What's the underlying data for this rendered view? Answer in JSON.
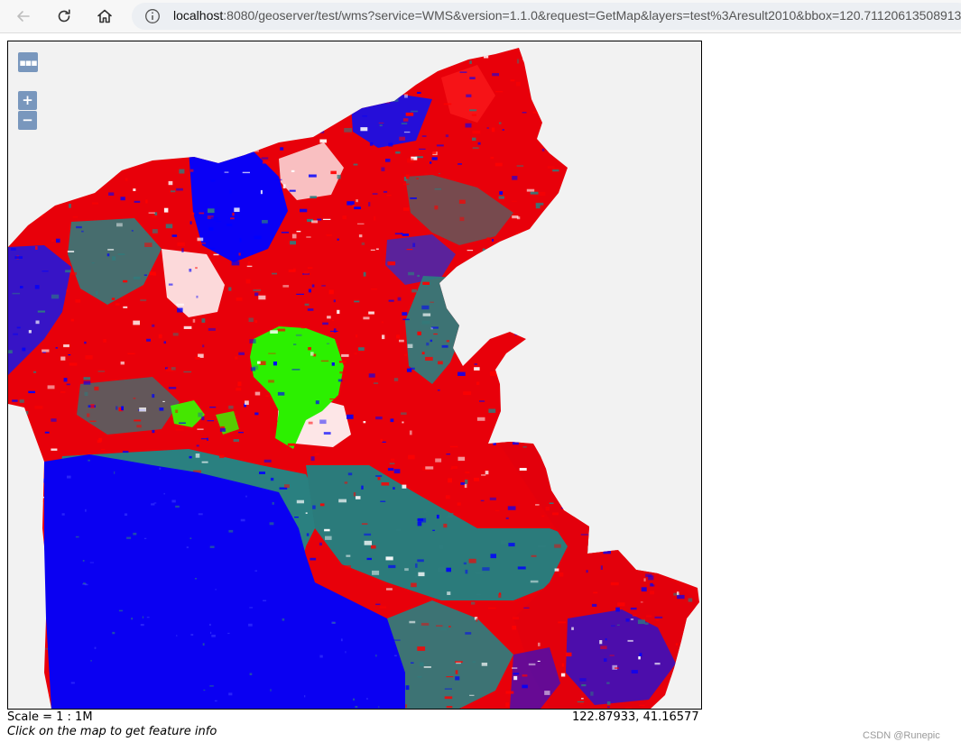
{
  "browser": {
    "url_host": "localhost",
    "url_rest": ":8080/geoserver/test/wms?service=WMS&version=1.1.0&request=GetMap&layers=test%3Aresult2010&bbox=120.71120613508913"
  },
  "map": {
    "controls": {
      "toggle_label": "▪▪▪",
      "zoom_in_label": "+",
      "zoom_out_label": "−"
    },
    "legend_colors": {
      "class_red": "#ff0000",
      "class_blue": "#0000ff",
      "class_teal": "#2e7d7e",
      "class_green": "#33ff00",
      "background": "#f2f2f2"
    }
  },
  "footer": {
    "scale": "Scale = 1 : 1M",
    "coordinates": "122.87933, 41.16577",
    "hint": "Click on the map to get feature info"
  },
  "watermark": "CSDN @Runepic"
}
